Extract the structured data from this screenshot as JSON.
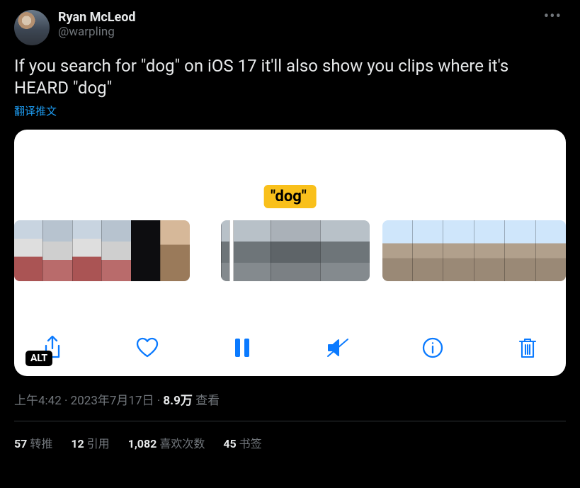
{
  "author": {
    "display_name": "Ryan McLeod",
    "handle": "@warpling"
  },
  "tweet_text": "If you search for \"dog\" on iOS 17 it'll also show you clips where it's HEARD \"dog\"",
  "translate_label": "翻译推文",
  "media": {
    "search_pill": "\"dog\"",
    "alt_badge": "ALT"
  },
  "meta": {
    "time": "上午4:42",
    "dot": " · ",
    "date": "2023年7月17日",
    "views_num": "8.9万",
    "views_label": " 查看"
  },
  "stats": {
    "retweets_num": "57",
    "retweets_label": " 转推",
    "quotes_num": "12",
    "quotes_label": " 引用",
    "likes_num": "1,082",
    "likes_label": " 喜欢次数",
    "bookmarks_num": "45",
    "bookmarks_label": " 书签"
  }
}
